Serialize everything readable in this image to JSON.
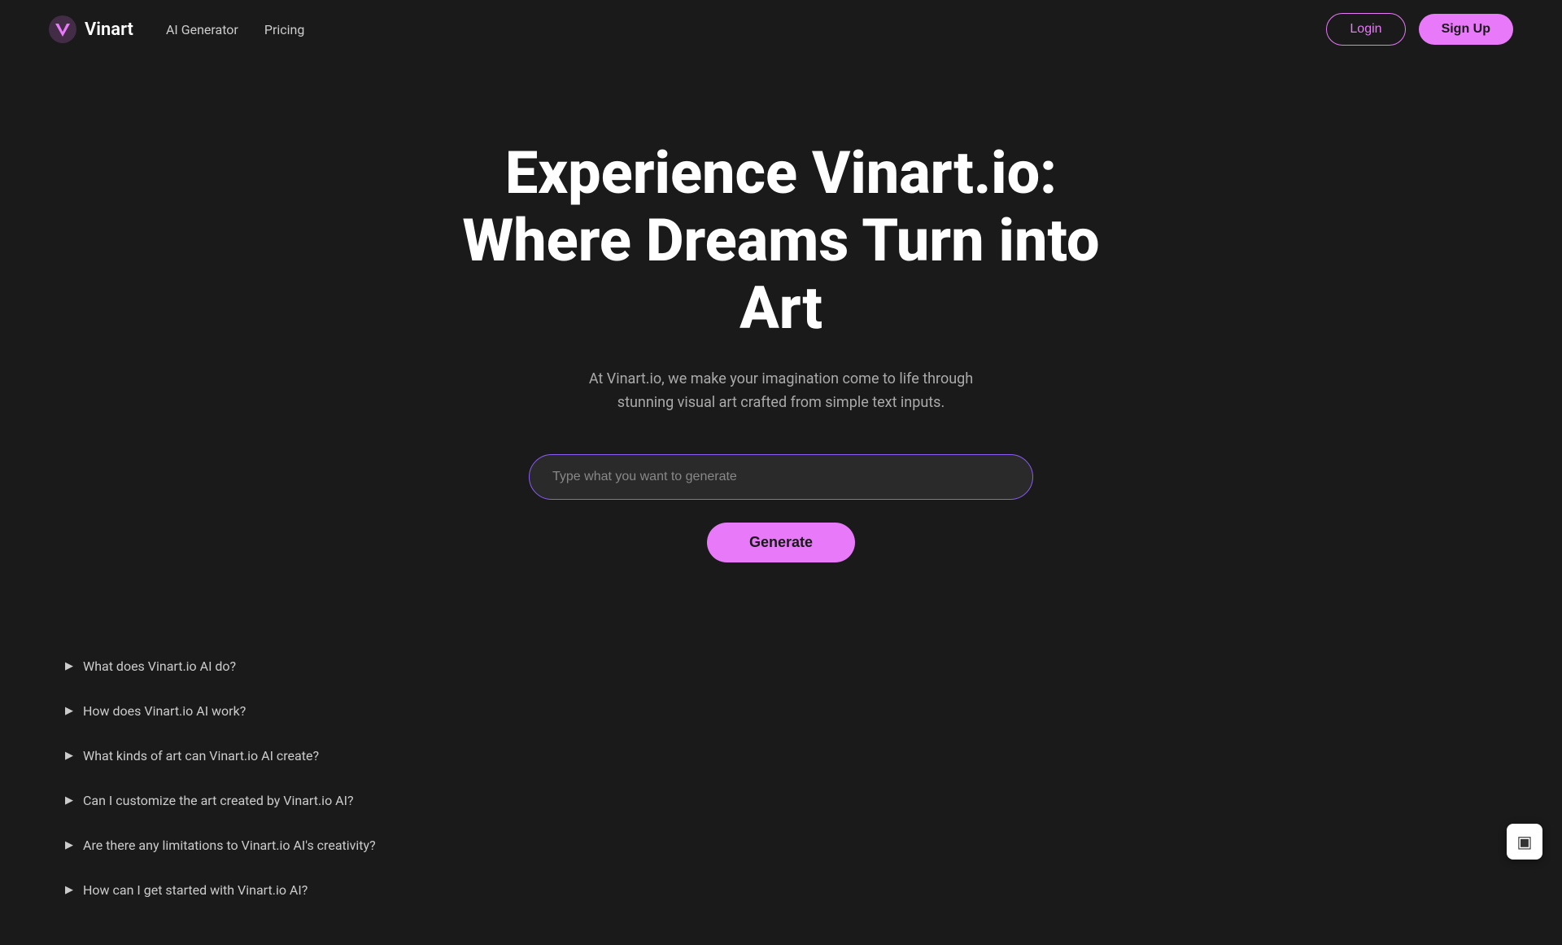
{
  "nav": {
    "logo_text": "Vinart",
    "links": [
      {
        "label": "AI Generator",
        "id": "ai-generator"
      },
      {
        "label": "Pricing",
        "id": "pricing"
      }
    ],
    "login_label": "Login",
    "signup_label": "Sign Up"
  },
  "hero": {
    "title": "Experience Vinart.io: Where Dreams Turn into Art",
    "subtitle": "At Vinart.io, we make your imagination come to life through stunning visual art crafted from simple text inputs.",
    "input_placeholder": "Type what you want to generate",
    "generate_label": "Generate"
  },
  "faq": {
    "items": [
      {
        "question": "What does Vinart.io AI do?"
      },
      {
        "question": "How does Vinart.io AI work?"
      },
      {
        "question": "What kinds of art can Vinart.io AI create?"
      },
      {
        "question": "Can I customize the art created by Vinart.io AI?"
      },
      {
        "question": "Are there any limitations to Vinart.io AI's creativity?"
      },
      {
        "question": "How can I get started with Vinart.io AI?"
      }
    ]
  },
  "colors": {
    "accent": "#e879f9",
    "bg": "#1a1a1a"
  }
}
